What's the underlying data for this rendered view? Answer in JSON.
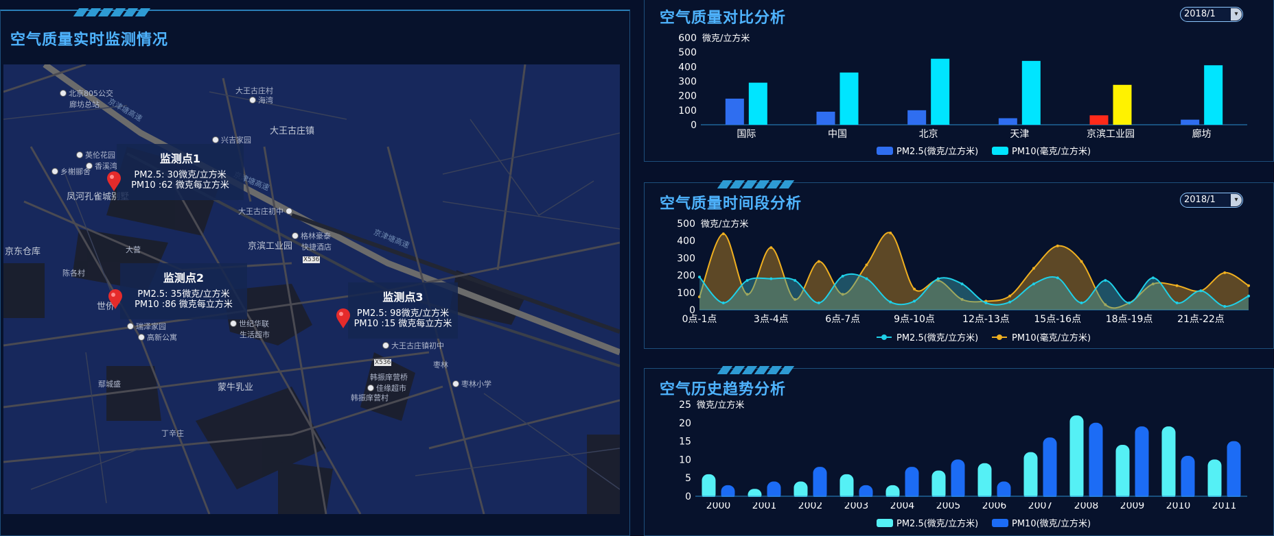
{
  "left": {
    "title": "空气质量实时监测情况",
    "map_labels": [
      {
        "text": "北京805公交",
        "sub": "廊坊总站",
        "poi": true
      },
      {
        "text": "大王古庄村",
        "poi": false
      },
      {
        "text": "海湾",
        "poi": true
      },
      {
        "text": "京津塘高速",
        "poi": false
      },
      {
        "text": "大王古庄镇",
        "poi": false
      },
      {
        "text": "兴吉家园",
        "poi": true
      },
      {
        "text": "英伦花园",
        "poi": true
      },
      {
        "text": "香溪湾",
        "poi": true
      },
      {
        "text": "乡榭郦舍",
        "poi": true
      },
      {
        "text": "凤河孔雀城别墅",
        "poi": false
      },
      {
        "text": "京津塘高速",
        "poi": false
      },
      {
        "text": "大王古庄初中",
        "poi": true
      },
      {
        "text": "京津塘高速",
        "poi": false
      },
      {
        "text": "格林豪泰",
        "sub": "快捷酒店",
        "poi": true
      },
      {
        "text": "京滨工业园",
        "poi": false
      },
      {
        "text": "京东仓库",
        "poi": false
      },
      {
        "text": "大营",
        "poi": false
      },
      {
        "text": "X536",
        "poi": false
      },
      {
        "text": "陈各村",
        "poi": false
      },
      {
        "text": "世侨",
        "poi": false
      },
      {
        "text": "瑞泽家园",
        "poi": true
      },
      {
        "text": "高新公寓",
        "poi": true
      },
      {
        "text": "世纪华联",
        "sub": "生活超市",
        "poi": true
      },
      {
        "text": "大王古庄镇初中",
        "poi": true
      },
      {
        "text": "X536",
        "poi": false
      },
      {
        "text": "枣林",
        "poi": false
      },
      {
        "text": "韩振庠营桥",
        "poi": false
      },
      {
        "text": "佳缘超市",
        "poi": true
      },
      {
        "text": "枣林小学",
        "poi": true
      },
      {
        "text": "韩振庠营村",
        "poi": false
      },
      {
        "text": "蒙牛乳业",
        "poi": false
      },
      {
        "text": "鄢城盛",
        "poi": false
      },
      {
        "text": "丁辛庄",
        "poi": false
      }
    ],
    "monitors": [
      {
        "name": "监测点1",
        "pm25": "PM2.5: 30微克/立方米",
        "pm10": "PM10 :62 微克每立方米"
      },
      {
        "name": "监测点2",
        "pm25": "PM2.5: 35微克/立方米",
        "pm10": "PM10 :86 微克每立方米"
      },
      {
        "name": "监测点3",
        "pm25": "PM2.5: 98微克/立方米",
        "pm10": "PM10 :15 微克每立方米"
      }
    ]
  },
  "panels": {
    "compare": {
      "title": "空气质量对比分析",
      "select_value": "2018/1"
    },
    "period": {
      "title": "空气质量时间段分析",
      "select_value": "2018/1"
    },
    "history": {
      "title": "空气历史趋势分析"
    }
  },
  "chart_data": [
    {
      "type": "bar",
      "title": "空气质量对比分析",
      "ylabel": "微克/立方米",
      "ylim": [
        0,
        600
      ],
      "yticks": [
        "0",
        "100",
        "200",
        "300",
        "400",
        "500",
        "600"
      ],
      "categories": [
        "国际",
        "中国",
        "北京",
        "天津",
        "京滨工业园",
        "廊坊"
      ],
      "series": [
        {
          "name": "PM2.5(微克/立方米)",
          "values": [
            180,
            90,
            100,
            45,
            65,
            35
          ],
          "color": "#2f6ef0"
        },
        {
          "name": "PM10(毫克/立方米)",
          "values": [
            290,
            360,
            455,
            440,
            275,
            410
          ],
          "color": "#00e5ff"
        }
      ],
      "highlight": {
        "category": "京滨工业园",
        "colors": [
          "#ff2a1a",
          "#fff200"
        ]
      },
      "legend": "bottom"
    },
    {
      "type": "area",
      "title": "空气质量时间段分析",
      "ylabel": "微克/立方米",
      "ylim": [
        0,
        500
      ],
      "yticks": [
        "0",
        "100",
        "200",
        "300",
        "400",
        "500"
      ],
      "xtick_labels": [
        "0点-1点",
        "3点-4点",
        "6点-7点",
        "9点-10点",
        "12点-13点",
        "15点-16点",
        "18点-19点",
        "21点-22点"
      ],
      "x_count": 24,
      "series": [
        {
          "name": "PM2.5(微克/立方米)",
          "color": "#1fd0e8",
          "values": [
            190,
            40,
            170,
            180,
            170,
            40,
            195,
            180,
            45,
            50,
            180,
            150,
            40,
            45,
            150,
            185,
            40,
            170,
            40,
            185,
            40,
            110,
            20,
            80
          ]
        },
        {
          "name": "PM10(毫克/立方米)",
          "color": "#f0b020",
          "values": [
            75,
            440,
            90,
            360,
            60,
            280,
            90,
            260,
            445,
            120,
            170,
            60,
            50,
            80,
            240,
            370,
            280,
            30,
            40,
            150,
            140,
            110,
            215,
            140
          ]
        }
      ],
      "legend": "bottom"
    },
    {
      "type": "bar",
      "title": "空气历史趋势分析",
      "ylabel": "微克/立方米",
      "ylim": [
        0,
        25
      ],
      "yticks": [
        "0",
        "5",
        "10",
        "15",
        "20",
        "25"
      ],
      "categories": [
        "2000",
        "2001",
        "2002",
        "2003",
        "2004",
        "2005",
        "2006",
        "2007",
        "2008",
        "2009",
        "2010",
        "2011"
      ],
      "series": [
        {
          "name": "PM2.5(微克/立方米)",
          "values": [
            6,
            2,
            4,
            6,
            3,
            7,
            9,
            12,
            22,
            14,
            19,
            10
          ],
          "color": "#55f0f5"
        },
        {
          "name": "PM10(微克/立方米)",
          "values": [
            3,
            4,
            8,
            3,
            8,
            10,
            4,
            16,
            20,
            19,
            11,
            15
          ],
          "color": "#1c6cf5"
        }
      ],
      "legend": "bottom"
    }
  ]
}
